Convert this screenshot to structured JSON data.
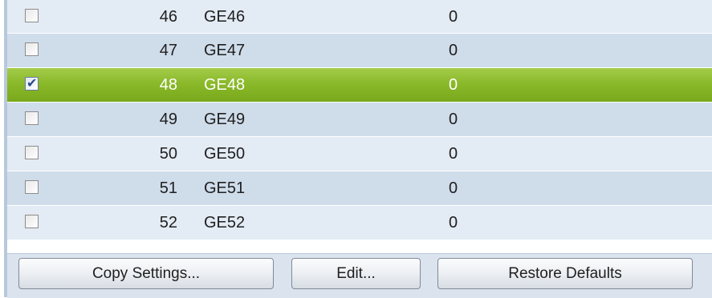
{
  "rows": [
    {
      "num": "46",
      "port": "GE46",
      "value": "0",
      "checked": false,
      "selected": false
    },
    {
      "num": "47",
      "port": "GE47",
      "value": "0",
      "checked": false,
      "selected": false
    },
    {
      "num": "48",
      "port": "GE48",
      "value": "0",
      "checked": true,
      "selected": true
    },
    {
      "num": "49",
      "port": "GE49",
      "value": "0",
      "checked": false,
      "selected": false
    },
    {
      "num": "50",
      "port": "GE50",
      "value": "0",
      "checked": false,
      "selected": false
    },
    {
      "num": "51",
      "port": "GE51",
      "value": "0",
      "checked": false,
      "selected": false
    },
    {
      "num": "52",
      "port": "GE52",
      "value": "0",
      "checked": false,
      "selected": false
    }
  ],
  "toolbar": {
    "copy_label": "Copy Settings...",
    "edit_label": "Edit...",
    "restore_label": "Restore Defaults"
  },
  "colors": {
    "row_even": "#e3ebf4",
    "row_odd": "#cfdcea",
    "row_selected": "#8ab92a"
  },
  "icons": {
    "checkbox_checked": "checkmark-icon"
  }
}
